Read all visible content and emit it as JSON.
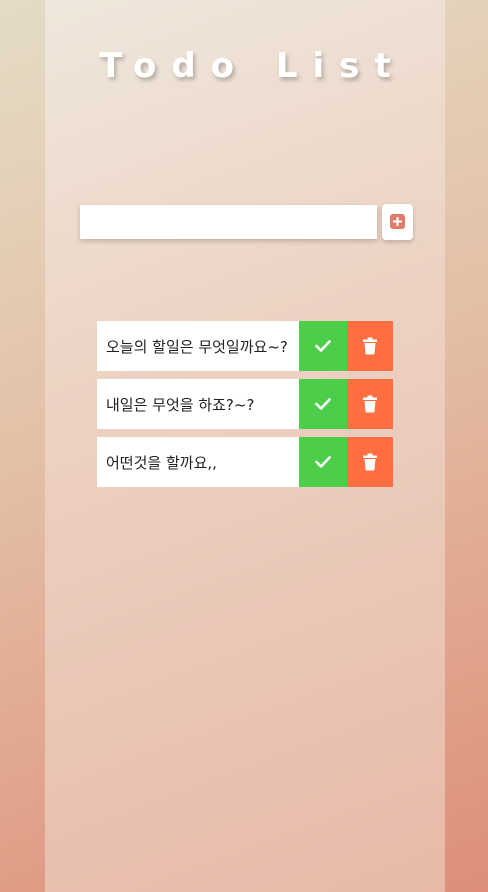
{
  "app": {
    "title": "Todo List"
  },
  "input": {
    "value": "",
    "placeholder": ""
  },
  "add_button": {
    "icon": "plus-square-icon"
  },
  "todos": [
    {
      "text": "오늘의 할일은 무엇일까요~?",
      "done_icon": "check-icon",
      "delete_icon": "trash-icon"
    },
    {
      "text": "내일은 무엇을 하죠?~?",
      "done_icon": "check-icon",
      "delete_icon": "trash-icon"
    },
    {
      "text": "어떤것을 할까요,,",
      "done_icon": "check-icon",
      "delete_icon": "trash-icon"
    }
  ],
  "colors": {
    "done": "#4cce4a",
    "delete": "#ff6e40",
    "add_icon": "#e07a6a"
  }
}
